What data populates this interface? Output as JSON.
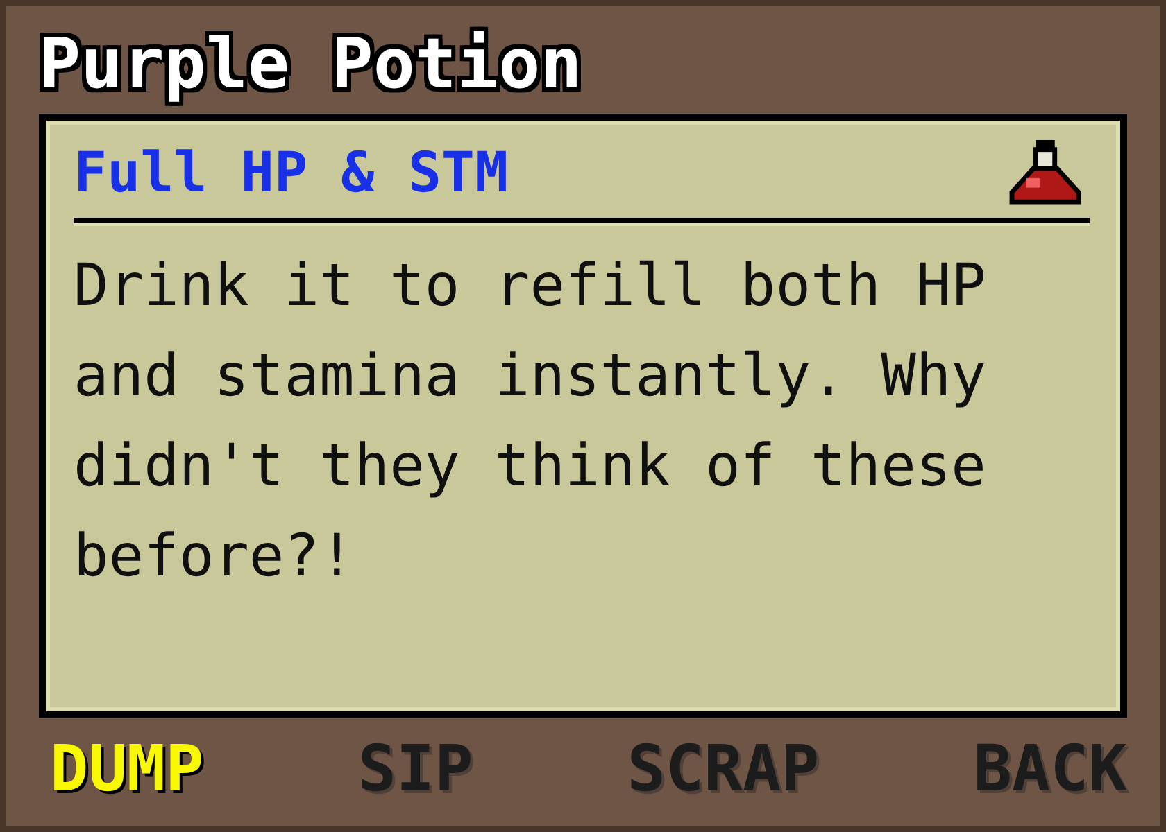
{
  "window": {
    "title": "Purple Potion"
  },
  "item": {
    "subtitle": "Full HP & STM",
    "description": "Drink it to refill both HP and stamina instantly. Why didn't they think of these before?!"
  },
  "menu": [
    {
      "label": "DUMP",
      "selected": true
    },
    {
      "label": "SIP",
      "selected": false
    },
    {
      "label": "SCRAP",
      "selected": false
    },
    {
      "label": "BACK",
      "selected": false
    }
  ]
}
